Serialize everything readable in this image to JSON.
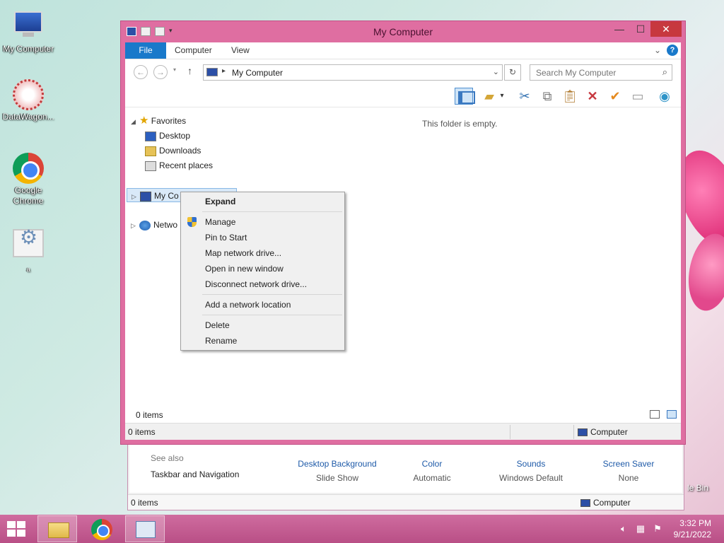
{
  "desktop": {
    "icons": [
      {
        "label": "My Computer"
      },
      {
        "label": "DataWagon..."
      },
      {
        "label": "Google Chrome"
      },
      {
        "label": "a"
      }
    ],
    "recycle_bin_partial": "le Bin"
  },
  "background_window": {
    "see_also": "See also",
    "taskbar_link": "Taskbar and Navigation",
    "items": [
      {
        "label": "Desktop Background",
        "sub": "Slide Show"
      },
      {
        "label": "Color",
        "sub": "Automatic"
      },
      {
        "label": "Sounds",
        "sub": "Windows Default"
      },
      {
        "label": "Screen Saver",
        "sub": "None"
      }
    ],
    "status_count": "0 items",
    "status_location": "Computer"
  },
  "window": {
    "title": "My Computer",
    "controls": {
      "minimize": "—",
      "maximize": "☐",
      "close": "✕"
    },
    "ribbon_tabs": [
      "File",
      "Computer",
      "View"
    ],
    "address": {
      "location": "My Computer",
      "search_placeholder": "Search My Computer"
    },
    "tree": {
      "favorites": "Favorites",
      "desktop": "Desktop",
      "downloads": "Downloads",
      "recent": "Recent places",
      "my_computer": "My Co",
      "network": "Netwo"
    },
    "empty_message": "This folder is empty.",
    "footer_count": "0 items",
    "status_count": "0 items",
    "status_location": "Computer"
  },
  "context_menu": {
    "items": [
      "Expand",
      "Manage",
      "Pin to Start",
      "Map network drive...",
      "Open in new window",
      "Disconnect network drive...",
      "Add a network location",
      "Delete",
      "Rename"
    ]
  },
  "taskbar": {
    "time": "3:32 PM",
    "date": "9/21/2022"
  },
  "colors": {
    "window_frame": "#df6ea1",
    "taskbar": "#c85f95",
    "file_tab": "#1979ca",
    "link": "#1e5aa8"
  }
}
